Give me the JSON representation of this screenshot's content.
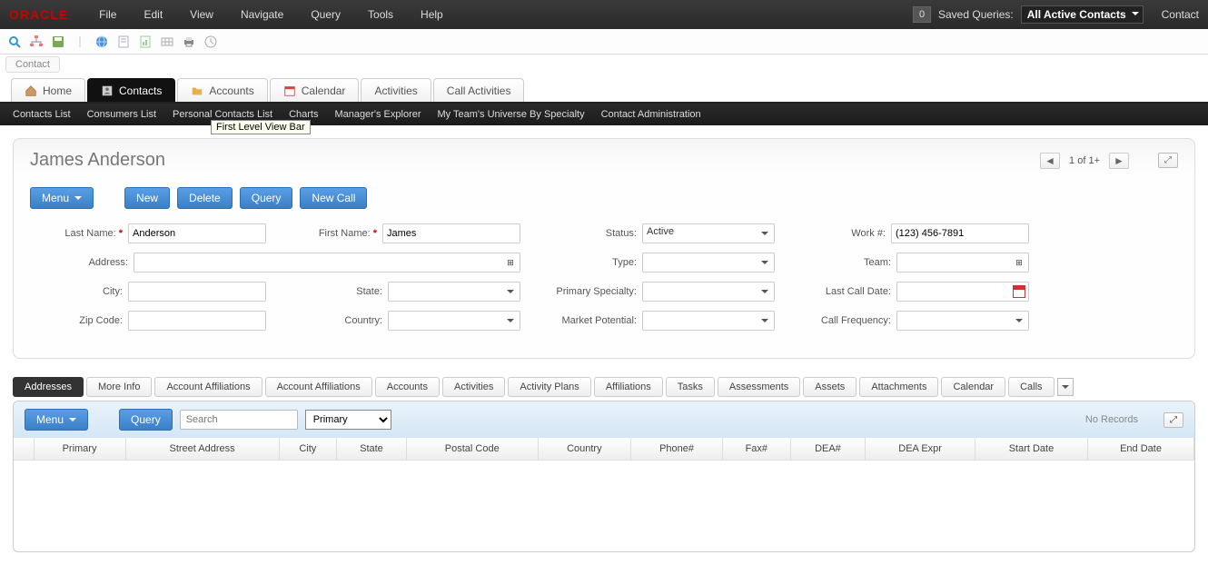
{
  "logo": "ORACLE",
  "top_menu": [
    "File",
    "Edit",
    "View",
    "Navigate",
    "Query",
    "Tools",
    "Help"
  ],
  "saved_queries_count": "0",
  "saved_queries_label": "Saved Queries:",
  "saved_query_selected": "All Active Contacts",
  "contact_link": "Contact",
  "breadcrumb": "Contact",
  "main_tabs": [
    {
      "label": "Home",
      "icon": "home"
    },
    {
      "label": "Contacts",
      "icon": "contacts",
      "active": true
    },
    {
      "label": "Accounts",
      "icon": "folder"
    },
    {
      "label": "Calendar",
      "icon": "calendar"
    },
    {
      "label": "Activities"
    },
    {
      "label": "Call Activities"
    }
  ],
  "subnav": [
    "Contacts List",
    "Consumers List",
    "Personal Contacts List",
    "Charts",
    "Manager's Explorer",
    "My Team's Universe By Specialty",
    "Contact Administration"
  ],
  "tooltip": "First Level View Bar",
  "panel_title": "James Anderson",
  "panel_nav": {
    "record_text": "1 of 1+"
  },
  "buttons": {
    "menu": "Menu",
    "new": "New",
    "delete": "Delete",
    "query": "Query",
    "newcall": "New Call"
  },
  "form": {
    "last_name": {
      "label": "Last Name:",
      "value": "Anderson",
      "required": true
    },
    "first_name": {
      "label": "First Name:",
      "value": "James",
      "required": true
    },
    "status": {
      "label": "Status:",
      "value": "Active"
    },
    "work": {
      "label": "Work #:",
      "value": "(123) 456-7891"
    },
    "address": {
      "label": "Address:",
      "value": ""
    },
    "type": {
      "label": "Type:",
      "value": ""
    },
    "team": {
      "label": "Team:",
      "value": ""
    },
    "city": {
      "label": "City:",
      "value": ""
    },
    "state": {
      "label": "State:",
      "value": ""
    },
    "primary_specialty": {
      "label": "Primary Specialty:",
      "value": ""
    },
    "last_call_date": {
      "label": "Last Call Date:",
      "value": ""
    },
    "zip": {
      "label": "Zip Code:",
      "value": ""
    },
    "country": {
      "label": "Country:",
      "value": ""
    },
    "market_potential": {
      "label": "Market Potential:",
      "value": ""
    },
    "call_frequency": {
      "label": "Call Frequency:",
      "value": ""
    }
  },
  "sec_tabs": [
    "Addresses",
    "More Info",
    "Account Affiliations",
    "Account Affiliations",
    "Accounts",
    "Activities",
    "Activity Plans",
    "Affiliations",
    "Tasks",
    "Assessments",
    "Assets",
    "Attachments",
    "Calendar",
    "Calls"
  ],
  "child": {
    "menu": "Menu",
    "query": "Query",
    "search_placeholder": "Search",
    "filter": "Primary",
    "no_records": "No Records",
    "columns": [
      "Primary",
      "Street Address",
      "City",
      "State",
      "Postal Code",
      "Country",
      "Phone#",
      "Fax#",
      "DEA#",
      "DEA Expr",
      "Start Date",
      "End Date"
    ]
  }
}
